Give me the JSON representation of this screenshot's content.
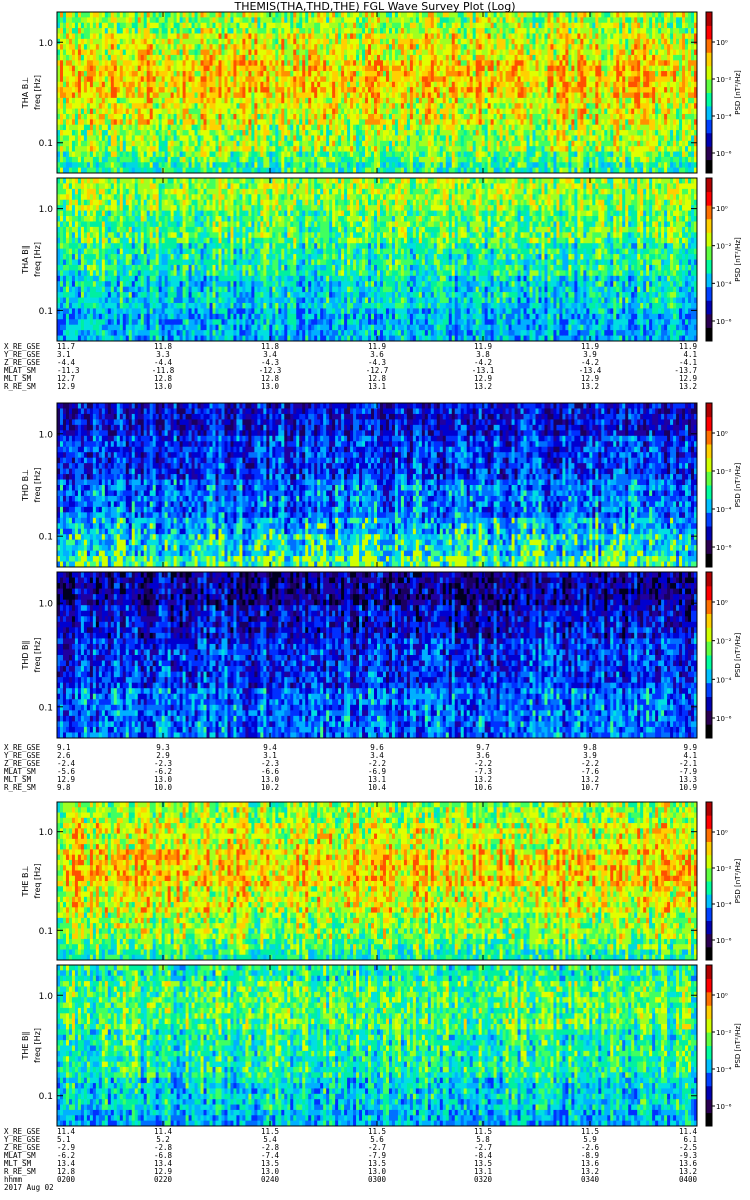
{
  "title": "THEMIS(THA,THD,THE) FGL Wave Survey Plot (Log)",
  "colorbar": {
    "label": "PSD [nT²/Hz]",
    "ticks": [
      "10⁰",
      "10⁻²",
      "10⁻⁴",
      "10⁻⁶"
    ],
    "colors": [
      "#000000",
      "#2a0050",
      "#0000b0",
      "#0040ff",
      "#00c0ff",
      "#00ffa0",
      "#60ff40",
      "#d0ff00",
      "#ffd000",
      "#ff7000",
      "#ff0000",
      "#b00000"
    ]
  },
  "chart_data": [
    {
      "type": "heatmap",
      "probe": "THA",
      "component": "B⊥",
      "ylabel": "THA B⊥ freq [Hz]",
      "yscale": "log",
      "ylim": [
        0.05,
        2.0
      ],
      "yticks": [
        "1.0",
        "0.1"
      ],
      "palette": [
        "#00b4ff",
        "#00d8e0",
        "#00f0a0",
        "#40ff60",
        "#a0ff20",
        "#e0ff00",
        "#ffd000",
        "#ff9000",
        "#ff5000"
      ],
      "bands": [
        [
          0.0,
          4
        ],
        [
          0.06,
          4
        ],
        [
          0.12,
          5
        ],
        [
          0.2,
          5
        ],
        [
          0.28,
          6
        ],
        [
          0.36,
          6
        ],
        [
          0.44,
          6
        ],
        [
          0.52,
          5
        ],
        [
          0.6,
          5
        ],
        [
          0.68,
          4
        ],
        [
          0.76,
          4
        ],
        [
          0.84,
          3
        ],
        [
          0.92,
          2
        ]
      ],
      "variability": 2,
      "seed": 11
    },
    {
      "type": "heatmap",
      "probe": "THA",
      "component": "B∥",
      "ylabel": "THA B∥ freq [Hz]",
      "yscale": "log",
      "ylim": [
        0.05,
        2.0
      ],
      "yticks": [
        "1.0",
        "0.1"
      ],
      "palette": [
        "#0030ff",
        "#0070ff",
        "#00b0ff",
        "#00e0e0",
        "#00f0a0",
        "#40ff60",
        "#a0ff20",
        "#e0ff00",
        "#ffd000"
      ],
      "bands": [
        [
          0.0,
          6
        ],
        [
          0.1,
          6
        ],
        [
          0.2,
          5
        ],
        [
          0.3,
          5
        ],
        [
          0.4,
          4
        ],
        [
          0.5,
          4
        ],
        [
          0.6,
          3
        ],
        [
          0.7,
          3
        ],
        [
          0.8,
          2
        ],
        [
          0.9,
          2
        ]
      ],
      "variability": 2,
      "seed": 23
    },
    {
      "type": "heatmap",
      "probe": "THD",
      "component": "B⊥",
      "ylabel": "THD B⊥ freq [Hz]",
      "yscale": "log",
      "ylim": [
        0.05,
        2.0
      ],
      "yticks": [
        "1.0",
        "0.1"
      ],
      "palette": [
        "#1a0060",
        "#2000a0",
        "#0000d0",
        "#0030ff",
        "#0070ff",
        "#00b0ff",
        "#00e0e0",
        "#40ff80",
        "#d0ff00"
      ],
      "bands": [
        [
          0.0,
          2
        ],
        [
          0.1,
          2
        ],
        [
          0.2,
          3
        ],
        [
          0.3,
          3
        ],
        [
          0.45,
          4
        ],
        [
          0.55,
          4
        ],
        [
          0.62,
          4
        ],
        [
          0.7,
          5
        ],
        [
          0.78,
          6
        ],
        [
          0.86,
          6
        ],
        [
          0.92,
          7
        ]
      ],
      "variability": 2,
      "seed": 37
    },
    {
      "type": "heatmap",
      "probe": "THD",
      "component": "B∥",
      "ylabel": "THD B∥ freq [Hz]",
      "yscale": "log",
      "ylim": [
        0.05,
        2.0
      ],
      "yticks": [
        "1.0",
        "0.1"
      ],
      "palette": [
        "#000020",
        "#1a0060",
        "#2000a0",
        "#0000d0",
        "#0030ff",
        "#0070ff",
        "#00b0ff",
        "#00e0e0",
        "#40ff80"
      ],
      "bands": [
        [
          0.0,
          2
        ],
        [
          0.1,
          2
        ],
        [
          0.2,
          3
        ],
        [
          0.3,
          3
        ],
        [
          0.4,
          4
        ],
        [
          0.5,
          4
        ],
        [
          0.6,
          4
        ],
        [
          0.7,
          5
        ],
        [
          0.8,
          5
        ],
        [
          0.9,
          5
        ]
      ],
      "variability": 2,
      "seed": 41
    },
    {
      "type": "heatmap",
      "probe": "THE",
      "component": "B⊥",
      "ylabel": "THE B⊥ freq [Hz]",
      "yscale": "log",
      "ylim": [
        0.05,
        2.0
      ],
      "yticks": [
        "1.0",
        "0.1"
      ],
      "palette": [
        "#00b4ff",
        "#00d8e0",
        "#00f0a0",
        "#40ff60",
        "#a0ff20",
        "#e0ff00",
        "#ffd000",
        "#ff9000",
        "#ff5000"
      ],
      "bands": [
        [
          0.0,
          4
        ],
        [
          0.06,
          4
        ],
        [
          0.12,
          5
        ],
        [
          0.2,
          5
        ],
        [
          0.28,
          6
        ],
        [
          0.36,
          6
        ],
        [
          0.44,
          6
        ],
        [
          0.52,
          5
        ],
        [
          0.6,
          5
        ],
        [
          0.68,
          4
        ],
        [
          0.76,
          4
        ],
        [
          0.84,
          3
        ],
        [
          0.92,
          2
        ]
      ],
      "variability": 2,
      "seed": 53
    },
    {
      "type": "heatmap",
      "probe": "THE",
      "component": "B∥",
      "ylabel": "THE B∥ freq [Hz]",
      "yscale": "log",
      "ylim": [
        0.05,
        2.0
      ],
      "yticks": [
        "1.0",
        "0.1"
      ],
      "palette": [
        "#0030ff",
        "#0070ff",
        "#00b0ff",
        "#00e0e0",
        "#00f0a0",
        "#40ff60",
        "#a0ff20",
        "#e0ff00",
        "#ffd000"
      ],
      "bands": [
        [
          0.0,
          4
        ],
        [
          0.1,
          5
        ],
        [
          0.2,
          5
        ],
        [
          0.3,
          5
        ],
        [
          0.4,
          4
        ],
        [
          0.5,
          4
        ],
        [
          0.6,
          4
        ],
        [
          0.7,
          3
        ],
        [
          0.8,
          3
        ],
        [
          0.9,
          2
        ]
      ],
      "variability": 2,
      "seed": 67
    }
  ],
  "ephemeris": [
    {
      "probe": "THA",
      "rows": [
        {
          "label": "X_RE_GSE",
          "values": [
            "11.7",
            "11.8",
            "11.8",
            "11.9",
            "11.9",
            "11.9",
            "11.9"
          ]
        },
        {
          "label": "Y_RE_GSE",
          "values": [
            "3.1",
            "3.3",
            "3.4",
            "3.6",
            "3.8",
            "3.9",
            "4.1"
          ]
        },
        {
          "label": "Z_RE_GSE",
          "values": [
            "-4.4",
            "-4.4",
            "-4.3",
            "-4.3",
            "-4.2",
            "-4.2",
            "-4.1"
          ]
        },
        {
          "label": "MLAT_SM",
          "values": [
            "-11.3",
            "-11.8",
            "-12.3",
            "-12.7",
            "-13.1",
            "-13.4",
            "-13.7"
          ]
        },
        {
          "label": "MLT_SM",
          "values": [
            "12.7",
            "12.8",
            "12.8",
            "12.8",
            "12.9",
            "12.9",
            "12.9"
          ]
        },
        {
          "label": "R_RE_SM",
          "values": [
            "12.9",
            "13.0",
            "13.0",
            "13.1",
            "13.2",
            "13.2",
            "13.2"
          ]
        }
      ]
    },
    {
      "probe": "THD",
      "rows": [
        {
          "label": "X_RE_GSE",
          "values": [
            "9.1",
            "9.3",
            "9.4",
            "9.6",
            "9.7",
            "9.8",
            "9.9"
          ]
        },
        {
          "label": "Y_RE_GSE",
          "values": [
            "2.6",
            "2.9",
            "3.1",
            "3.4",
            "3.6",
            "3.9",
            "4.1"
          ]
        },
        {
          "label": "Z_RE_GSE",
          "values": [
            "-2.4",
            "-2.3",
            "-2.3",
            "-2.2",
            "-2.2",
            "-2.2",
            "-2.1"
          ]
        },
        {
          "label": "MLAT_SM",
          "values": [
            "-5.6",
            "-6.2",
            "-6.6",
            "-6.9",
            "-7.3",
            "-7.6",
            "-7.9"
          ]
        },
        {
          "label": "MLT_SM",
          "values": [
            "12.9",
            "13.0",
            "13.0",
            "13.1",
            "13.2",
            "13.2",
            "13.3"
          ]
        },
        {
          "label": "R_RE_SM",
          "values": [
            "9.8",
            "10.0",
            "10.2",
            "10.4",
            "10.6",
            "10.7",
            "10.9"
          ]
        }
      ]
    },
    {
      "probe": "THE",
      "rows": [
        {
          "label": "X_RE_GSE",
          "values": [
            "11.4",
            "11.4",
            "11.5",
            "11.5",
            "11.5",
            "11.5",
            "11.4"
          ]
        },
        {
          "label": "Y_RE_GSE",
          "values": [
            "5.1",
            "5.2",
            "5.4",
            "5.6",
            "5.8",
            "5.9",
            "6.1"
          ]
        },
        {
          "label": "Z_RE_GSE",
          "values": [
            "-2.9",
            "-2.8",
            "-2.8",
            "-2.7",
            "-2.7",
            "-2.6",
            "-2.5"
          ]
        },
        {
          "label": "MLAT_SM",
          "values": [
            "-6.2",
            "-6.8",
            "-7.4",
            "-7.9",
            "-8.4",
            "-8.9",
            "-9.3"
          ]
        },
        {
          "label": "MLT_SM",
          "values": [
            "13.4",
            "13.4",
            "13.5",
            "13.5",
            "13.5",
            "13.6",
            "13.6"
          ]
        },
        {
          "label": "R_RE_SM",
          "values": [
            "12.8",
            "12.9",
            "13.0",
            "13.0",
            "13.1",
            "13.2",
            "13.2"
          ]
        },
        {
          "label": "hhmm",
          "values": [
            "0200",
            "0220",
            "0240",
            "0300",
            "0320",
            "0340",
            "0400"
          ]
        }
      ],
      "date": "2017 Aug 02"
    }
  ]
}
